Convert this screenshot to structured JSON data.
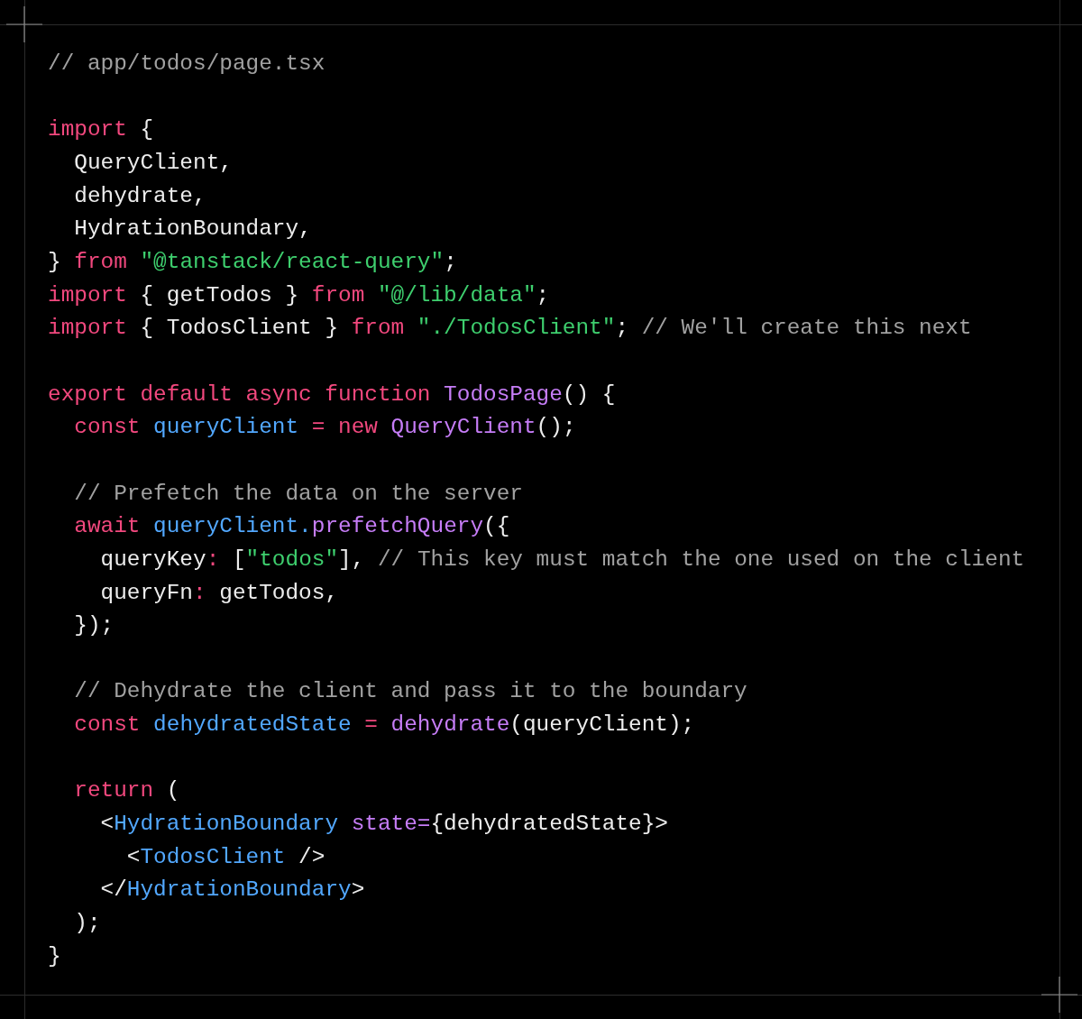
{
  "code_lines": [
    {
      "kind": "code",
      "tokens": [
        {
          "text": "// app/todos/page.tsx",
          "kind": "comment"
        }
      ]
    },
    {
      "kind": "blank"
    },
    {
      "kind": "code",
      "tokens": [
        {
          "text": "import",
          "kind": "keyword"
        },
        {
          "text": " {",
          "kind": "plain"
        }
      ]
    },
    {
      "kind": "code",
      "tokens": [
        {
          "text": "  QueryClient,",
          "kind": "plain"
        }
      ]
    },
    {
      "kind": "code",
      "tokens": [
        {
          "text": "  dehydrate,",
          "kind": "plain"
        }
      ]
    },
    {
      "kind": "code",
      "tokens": [
        {
          "text": "  HydrationBoundary,",
          "kind": "plain"
        }
      ]
    },
    {
      "kind": "code",
      "tokens": [
        {
          "text": "} ",
          "kind": "plain"
        },
        {
          "text": "from ",
          "kind": "keyword"
        },
        {
          "text": "\"@tanstack/react-query\"",
          "kind": "string"
        },
        {
          "text": ";",
          "kind": "plain"
        }
      ]
    },
    {
      "kind": "code",
      "tokens": [
        {
          "text": "import",
          "kind": "keyword"
        },
        {
          "text": " { getTodos } ",
          "kind": "plain"
        },
        {
          "text": "from ",
          "kind": "keyword"
        },
        {
          "text": "\"@/lib/data\"",
          "kind": "string"
        },
        {
          "text": ";",
          "kind": "plain"
        }
      ]
    },
    {
      "kind": "code",
      "tokens": [
        {
          "text": "import",
          "kind": "keyword"
        },
        {
          "text": " { TodosClient } ",
          "kind": "plain"
        },
        {
          "text": "from ",
          "kind": "keyword"
        },
        {
          "text": "\"./TodosClient\"",
          "kind": "string"
        },
        {
          "text": "; ",
          "kind": "plain"
        },
        {
          "text": "// We'll create this next",
          "kind": "comment"
        }
      ]
    },
    {
      "kind": "blank"
    },
    {
      "kind": "code",
      "tokens": [
        {
          "text": "export default async function ",
          "kind": "keyword"
        },
        {
          "text": "TodosPage",
          "kind": "function"
        },
        {
          "text": "() {",
          "kind": "plain"
        }
      ]
    },
    {
      "kind": "code",
      "tokens": [
        {
          "text": "  const ",
          "kind": "keyword"
        },
        {
          "text": "queryClient ",
          "kind": "variable"
        },
        {
          "text": "= new ",
          "kind": "keyword"
        },
        {
          "text": "QueryClient",
          "kind": "function"
        },
        {
          "text": "();",
          "kind": "plain"
        }
      ]
    },
    {
      "kind": "blank"
    },
    {
      "kind": "code",
      "tokens": [
        {
          "text": "  // Prefetch the data on the server",
          "kind": "comment"
        }
      ]
    },
    {
      "kind": "code",
      "tokens": [
        {
          "text": "  await ",
          "kind": "keyword"
        },
        {
          "text": "queryClient.",
          "kind": "variable"
        },
        {
          "text": "prefetchQuery",
          "kind": "function"
        },
        {
          "text": "({",
          "kind": "plain"
        }
      ]
    },
    {
      "kind": "code",
      "tokens": [
        {
          "text": "    queryKey",
          "kind": "plain"
        },
        {
          "text": ":",
          "kind": "keyword"
        },
        {
          "text": " [",
          "kind": "plain"
        },
        {
          "text": "\"todos\"",
          "kind": "string"
        },
        {
          "text": "], ",
          "kind": "plain"
        },
        {
          "text": "// This key must match the one used on the client",
          "kind": "comment"
        }
      ]
    },
    {
      "kind": "code",
      "tokens": [
        {
          "text": "    queryFn",
          "kind": "plain"
        },
        {
          "text": ":",
          "kind": "keyword"
        },
        {
          "text": " getTodos,",
          "kind": "plain"
        }
      ]
    },
    {
      "kind": "code",
      "tokens": [
        {
          "text": "  });",
          "kind": "plain"
        }
      ]
    },
    {
      "kind": "blank"
    },
    {
      "kind": "code",
      "tokens": [
        {
          "text": "  // Dehydrate the client and pass it to the boundary",
          "kind": "comment"
        }
      ]
    },
    {
      "kind": "code",
      "tokens": [
        {
          "text": "  const ",
          "kind": "keyword"
        },
        {
          "text": "dehydratedState ",
          "kind": "variable"
        },
        {
          "text": "= ",
          "kind": "keyword"
        },
        {
          "text": "dehydrate",
          "kind": "function"
        },
        {
          "text": "(queryClient);",
          "kind": "plain"
        }
      ]
    },
    {
      "kind": "blank"
    },
    {
      "kind": "code",
      "tokens": [
        {
          "text": "  return",
          "kind": "keyword"
        },
        {
          "text": " (",
          "kind": "plain"
        }
      ]
    },
    {
      "kind": "code",
      "tokens": [
        {
          "text": "    <",
          "kind": "plain"
        },
        {
          "text": "HydrationBoundary ",
          "kind": "variable"
        },
        {
          "text": "state=",
          "kind": "function"
        },
        {
          "text": "{dehydratedState}>",
          "kind": "plain"
        }
      ]
    },
    {
      "kind": "code",
      "tokens": [
        {
          "text": "      <",
          "kind": "plain"
        },
        {
          "text": "TodosClient",
          "kind": "variable"
        },
        {
          "text": " />",
          "kind": "plain"
        }
      ]
    },
    {
      "kind": "code",
      "tokens": [
        {
          "text": "    </",
          "kind": "plain"
        },
        {
          "text": "HydrationBoundary",
          "kind": "variable"
        },
        {
          "text": ">",
          "kind": "plain"
        }
      ]
    },
    {
      "kind": "code",
      "tokens": [
        {
          "text": "  );",
          "kind": "plain"
        }
      ]
    },
    {
      "kind": "code",
      "tokens": [
        {
          "text": "}",
          "kind": "plain"
        }
      ]
    }
  ]
}
